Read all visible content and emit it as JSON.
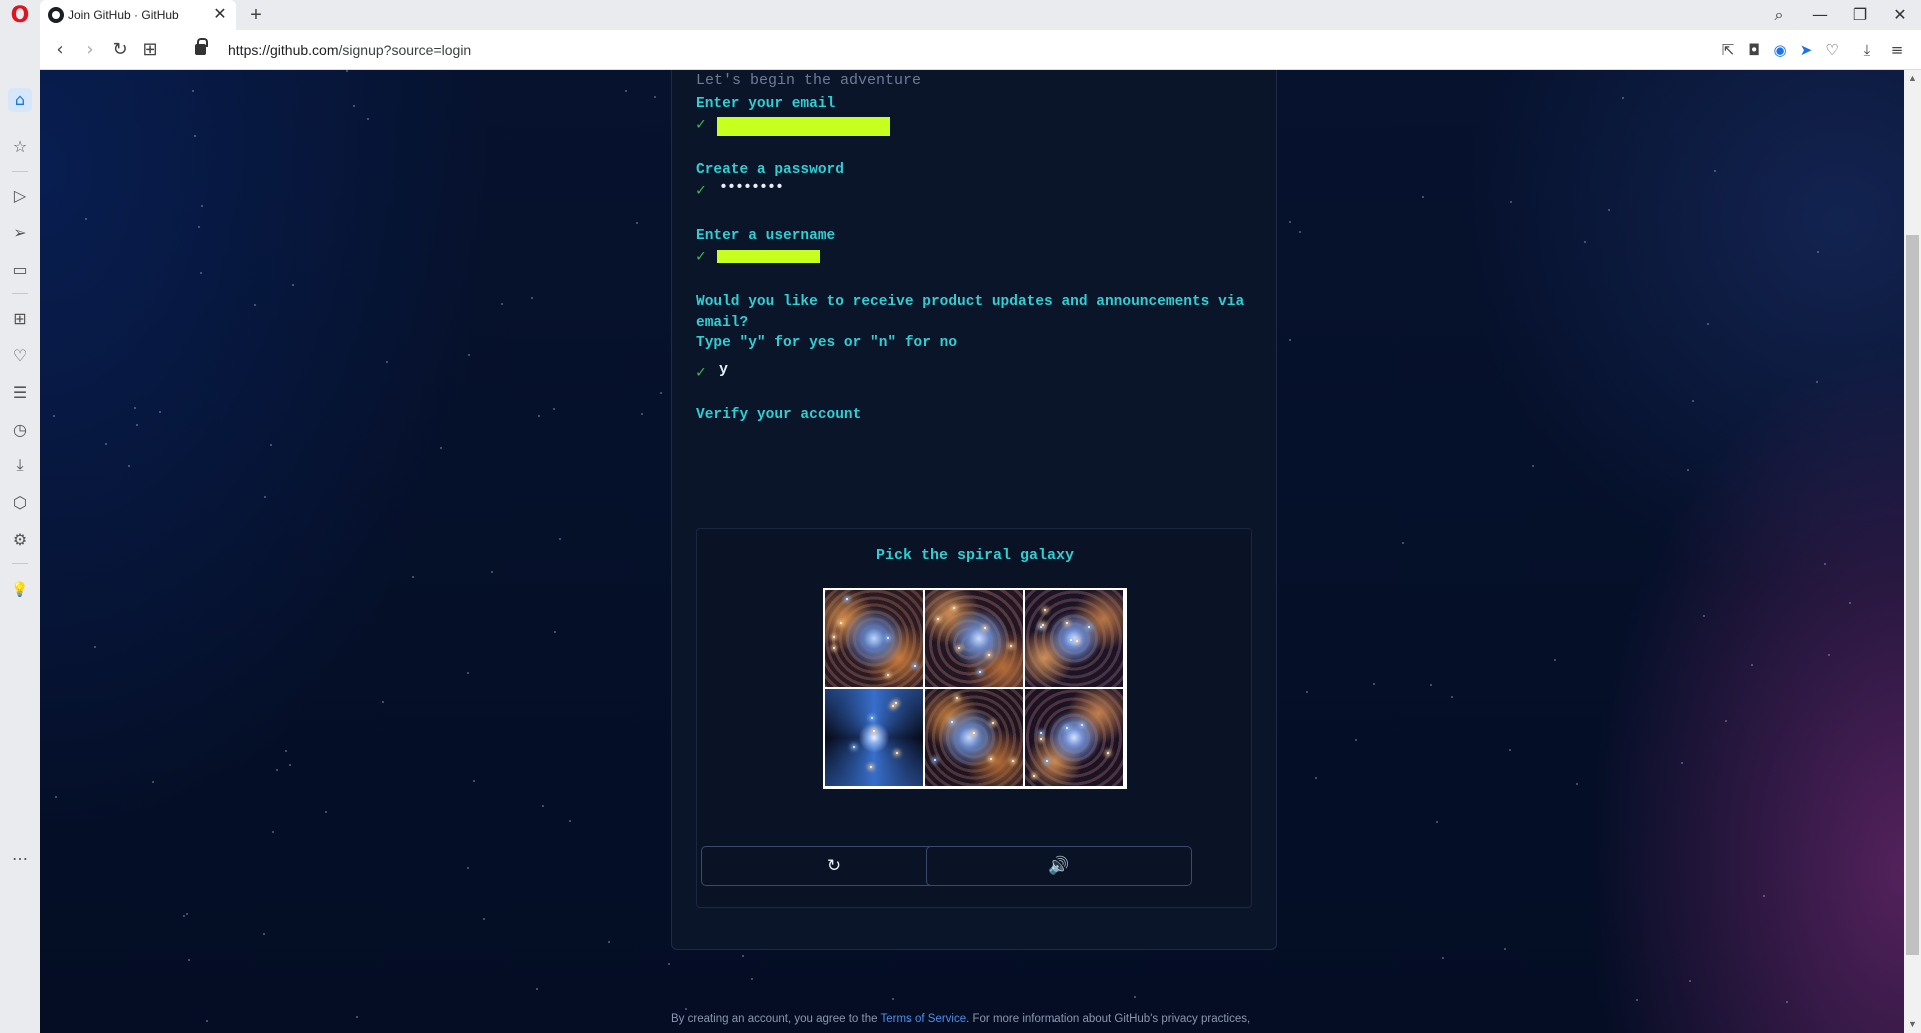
{
  "browser": {
    "tab_title": "Join GitHub · GitHub",
    "tab_close": "✕",
    "new_tab": "+",
    "url_host": "https://github.com",
    "url_path": "/signup?source=login",
    "window_controls": {
      "search": "⌕",
      "minimize": "—",
      "restore": "❐",
      "close": "✕"
    },
    "nav": {
      "back": "‹",
      "forward": "›",
      "reload": "↻",
      "tabs": "⊞"
    },
    "tools": [
      "⇱",
      "◘",
      "◉",
      "➤",
      "♡",
      "⤓",
      "≡"
    ],
    "sidebar_icons": [
      "⌂",
      "☆",
      "▷",
      "➢",
      "▭",
      "⊞",
      "♡",
      "☰",
      "◷",
      "⤓",
      "⬡",
      "⚙",
      "💡",
      "…"
    ]
  },
  "signup": {
    "tagline": "Let's begin the adventure",
    "email_label": "Enter your email",
    "password_label": "Create a password",
    "password_value": "••••••••",
    "username_label": "Enter a username",
    "updates_label_1": "Would you like to receive product updates and announcements via",
    "updates_label_2": "email?",
    "updates_label_3": "Type \"y\" for yes or \"n\" for no",
    "updates_value": "y",
    "verify_label": "Verify your account",
    "check_mark": "✓",
    "accent_color": "#2fcfd4",
    "highlight_color": "#c7ff1e"
  },
  "captcha": {
    "prompt": "Pick the spiral galaxy",
    "images": [
      "galaxy-image-1",
      "galaxy-image-2",
      "galaxy-image-3",
      "galaxy-image-4",
      "galaxy-image-5",
      "galaxy-image-6"
    ],
    "refresh_icon": "↻",
    "audio_icon": "🔊"
  },
  "footer": {
    "text_before": "By creating an account, you agree to the ",
    "link": "Terms of Service",
    "text_after": ". For more information about GitHub's privacy practices,"
  }
}
